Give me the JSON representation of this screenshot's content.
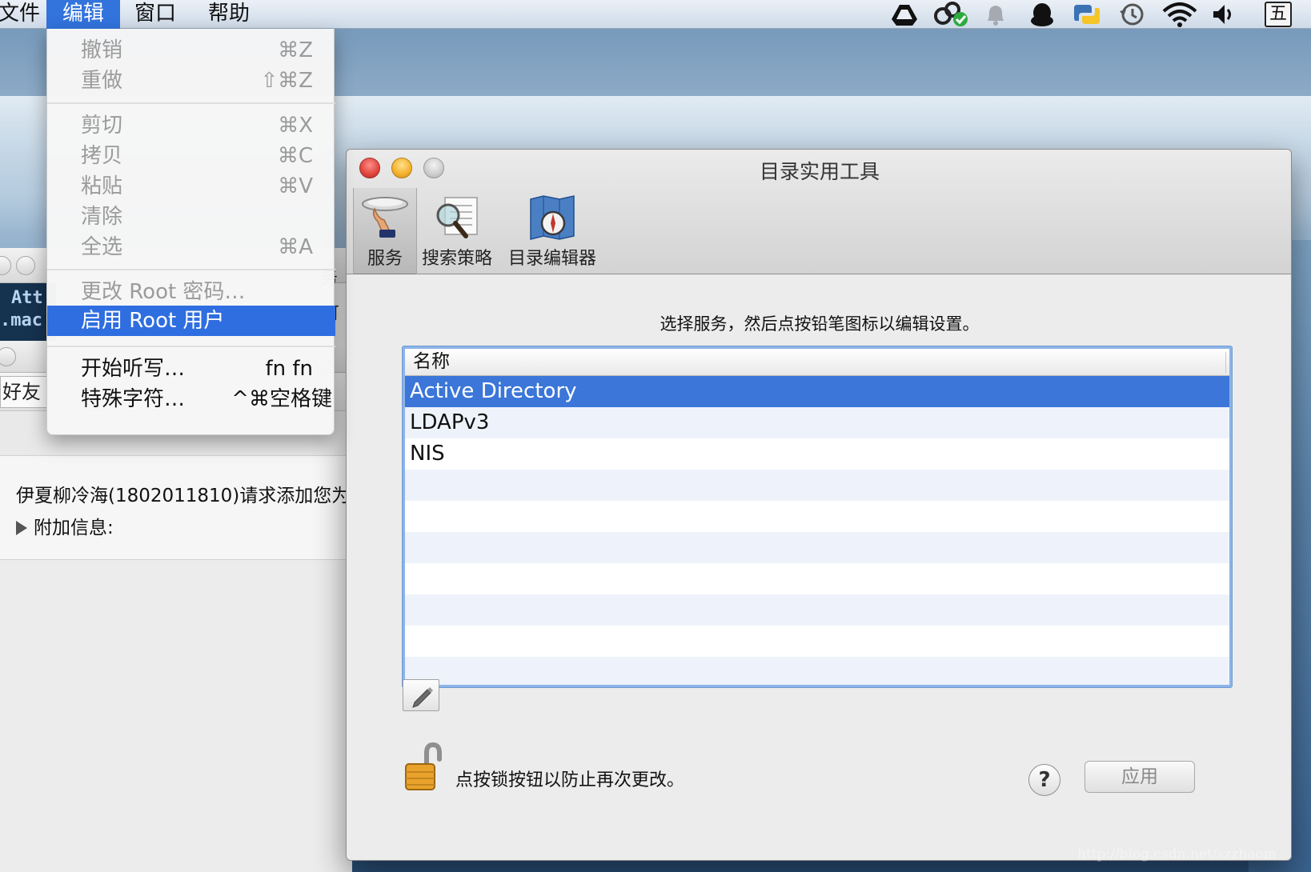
{
  "menubar": {
    "items": [
      "文件",
      "编辑",
      "窗口",
      "帮助"
    ],
    "file_partial": "文件",
    "active_item": "编辑",
    "status_icons": [
      "google-drive-icon",
      "sync-check-icon",
      "notification-bell-icon",
      "qq-penguin-icon",
      "python-icon",
      "time-machine-icon",
      "wifi-icon",
      "volume-icon",
      "input-method-icon"
    ],
    "input_method_label": "五"
  },
  "edit_menu": {
    "items": [
      {
        "label": "撤销",
        "shortcut": "⌘Z",
        "enabled": false
      },
      {
        "label": "重做",
        "shortcut": "⇧⌘Z",
        "enabled": false
      },
      {
        "label": "剪切",
        "shortcut": "⌘X",
        "enabled": false
      },
      {
        "label": "拷贝",
        "shortcut": "⌘C",
        "enabled": false
      },
      {
        "label": "粘贴",
        "shortcut": "⌘V",
        "enabled": false
      },
      {
        "label": "清除",
        "shortcut": "",
        "enabled": false
      },
      {
        "label": "全选",
        "shortcut": "⌘A",
        "enabled": false
      },
      {
        "label": "更改 Root 密码…",
        "shortcut": "",
        "enabled": false
      },
      {
        "label": "启用 Root 用户",
        "shortcut": "",
        "enabled": true,
        "highlighted": true
      },
      {
        "label": "开始听写…",
        "shortcut": "fn fn",
        "enabled": true
      },
      {
        "label": "特殊字符…",
        "shortcut": "^⌘空格键",
        "enabled": true
      }
    ]
  },
  "bg_window": {
    "code_lines": [
      "Att",
      ".mac"
    ],
    "friend_tab": "好友",
    "request_text": "伊夏柳冷海(1802011810)请求添加您为",
    "extra_info_label": "附加信息:",
    "peek_chars": [
      "务",
      "可"
    ]
  },
  "window": {
    "title": "目录实用工具",
    "toolbar": [
      {
        "label": "服务",
        "icon": "services-icon",
        "selected": true
      },
      {
        "label": "搜索策略",
        "icon": "search-policy-icon",
        "selected": false
      },
      {
        "label": "目录编辑器",
        "icon": "directory-editor-icon",
        "selected": false
      }
    ],
    "instruction": "选择服务，然后点按铅笔图标以编辑设置。",
    "list": {
      "column_header": "名称",
      "rows": [
        "Active Directory",
        "LDAPv3",
        "NIS"
      ],
      "selected_index": 0
    },
    "lock_text": "点按锁按钮以防止再次更改。",
    "help_label": "?",
    "apply_label": "应用"
  },
  "colors": {
    "menu_highlight": "#2f6ee0",
    "list_selection": "#3b76d8",
    "traffic_close": "#e0443e",
    "traffic_minimize": "#f4b02b"
  },
  "watermark": "http://blog.csdn.net/szzhaom"
}
